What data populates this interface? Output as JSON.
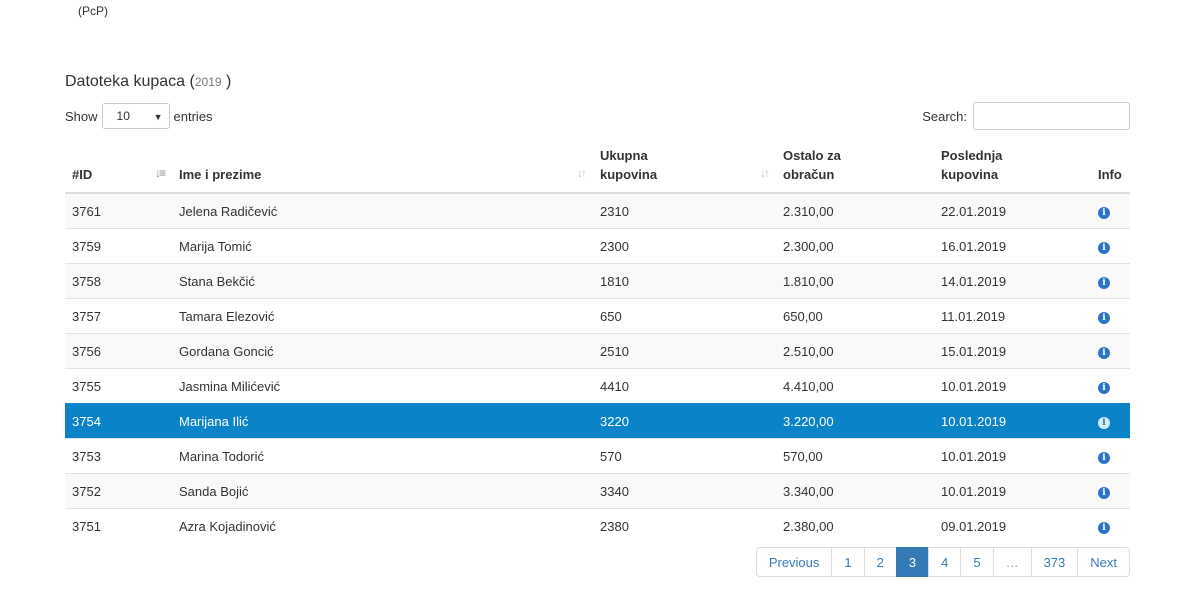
{
  "header_note": "(PcP)",
  "heading": {
    "title": "Datoteka kupaca (",
    "year": "2019",
    "close": ")"
  },
  "controls": {
    "show_label": "Show",
    "page_size": "10",
    "entries_label": "entries",
    "search_label": "Search:"
  },
  "columns": [
    "#ID",
    "Ime i prezime",
    "Ukupna\nkupovina",
    "Ostalo za\nobračun",
    "Poslednja\nkupovina",
    "Info"
  ],
  "rows": [
    {
      "id": "3761",
      "name": "Jelena Radičević",
      "total": "2310",
      "remaining": "2.310,00",
      "last": "22.01.2019"
    },
    {
      "id": "3759",
      "name": "Marija Tomić",
      "total": "2300",
      "remaining": "2.300,00",
      "last": "16.01.2019"
    },
    {
      "id": "3758",
      "name": "Stana Bekčić",
      "total": "1810",
      "remaining": "1.810,00",
      "last": "14.01.2019"
    },
    {
      "id": "3757",
      "name": "Tamara Elezović",
      "total": "650",
      "remaining": "650,00",
      "last": "11.01.2019"
    },
    {
      "id": "3756",
      "name": "Gordana Goncić",
      "total": "2510",
      "remaining": "2.510,00",
      "last": "15.01.2019"
    },
    {
      "id": "3755",
      "name": "Jasmina Milićević",
      "total": "4410",
      "remaining": "4.410,00",
      "last": "10.01.2019"
    },
    {
      "id": "3754",
      "name": "Marijana Ilić",
      "total": "3220",
      "remaining": "3.220,00",
      "last": "10.01.2019"
    },
    {
      "id": "3753",
      "name": "Marina Todorić",
      "total": "570",
      "remaining": "570,00",
      "last": "10.01.2019"
    },
    {
      "id": "3752",
      "name": "Sanda Bojić",
      "total": "3340",
      "remaining": "3.340,00",
      "last": "10.01.2019"
    },
    {
      "id": "3751",
      "name": "Azra Kojadinović",
      "total": "2380",
      "remaining": "2.380,00",
      "last": "09.01.2019"
    }
  ],
  "selected_row_id": "3754",
  "pagination": {
    "previous": "Previous",
    "pages": [
      "1",
      "2",
      "3",
      "4",
      "5",
      "…",
      "373"
    ],
    "current": "3",
    "next": "Next"
  },
  "colors": {
    "selected_row": "#0b83c9",
    "link": "#337ab7",
    "info_icon": "#2a74c9"
  },
  "icons": {
    "info": "info-circle-icon",
    "sort_desc": "sort-desc-icon",
    "sort": "sort-icon"
  }
}
